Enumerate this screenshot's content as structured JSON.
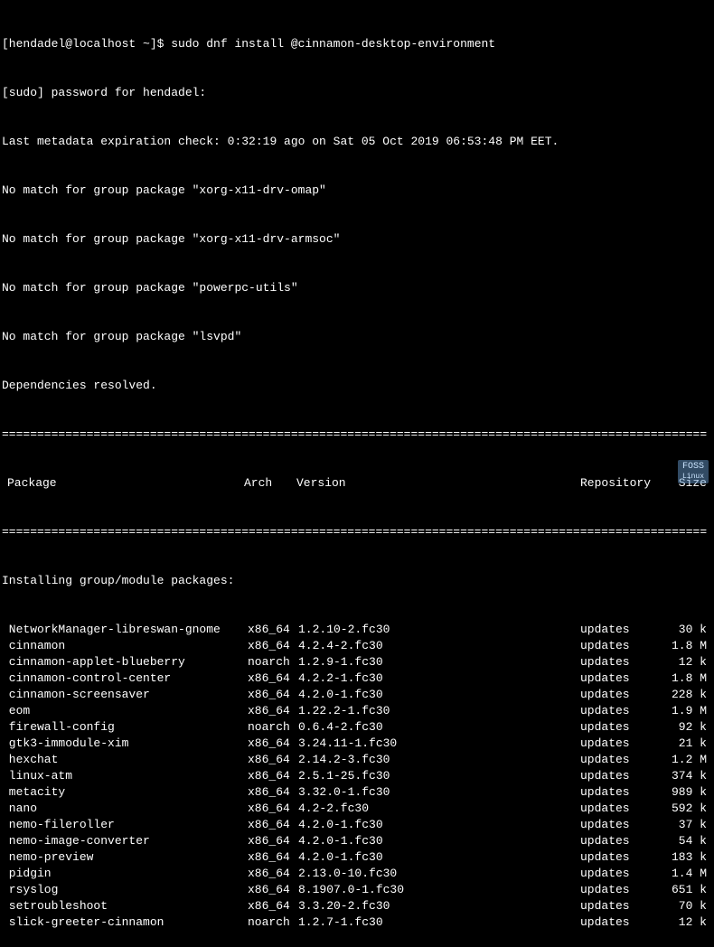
{
  "prompt": {
    "user_host": "[hendadel@localhost ~]$ ",
    "command": "sudo dnf install @cinnamon-desktop-environment",
    "sudo_line": "[sudo] password for hendadel:",
    "metadata_line": "Last metadata expiration check: 0:32:19 ago on Sat 05 Oct 2019 06:53:48 PM EET.",
    "no_match_lines": [
      "No match for group package \"xorg-x11-drv-omap\"",
      "No match for group package \"xorg-x11-drv-armsoc\"",
      "No match for group package \"powerpc-utils\"",
      "No match for group package \"lsvpd\""
    ],
    "deps_resolved": "Dependencies resolved."
  },
  "divider": "====================================================================================================",
  "headers": {
    "package": "Package",
    "arch": "Arch",
    "version": "Version",
    "repository": "Repository",
    "size": "Size"
  },
  "section_title": "Installing group/module packages:",
  "packages": [
    {
      "name": " NetworkManager-libreswan-gnome",
      "arch": "x86_64",
      "version": "1.2.10-2.fc30",
      "repo": "updates",
      "size": "30 k"
    },
    {
      "name": " cinnamon",
      "arch": "x86_64",
      "version": "4.2.4-2.fc30",
      "repo": "updates",
      "size": "1.8 M"
    },
    {
      "name": " cinnamon-applet-blueberry",
      "arch": "noarch",
      "version": "1.2.9-1.fc30",
      "repo": "updates",
      "size": "12 k"
    },
    {
      "name": " cinnamon-control-center",
      "arch": "x86_64",
      "version": "4.2.2-1.fc30",
      "repo": "updates",
      "size": "1.8 M"
    },
    {
      "name": " cinnamon-screensaver",
      "arch": "x86_64",
      "version": "4.2.0-1.fc30",
      "repo": "updates",
      "size": "228 k"
    },
    {
      "name": " eom",
      "arch": "x86_64",
      "version": "1.22.2-1.fc30",
      "repo": "updates",
      "size": "1.9 M"
    },
    {
      "name": " firewall-config",
      "arch": "noarch",
      "version": "0.6.4-2.fc30",
      "repo": "updates",
      "size": "92 k"
    },
    {
      "name": " gtk3-immodule-xim",
      "arch": "x86_64",
      "version": "3.24.11-1.fc30",
      "repo": "updates",
      "size": "21 k"
    },
    {
      "name": " hexchat",
      "arch": "x86_64",
      "version": "2.14.2-3.fc30",
      "repo": "updates",
      "size": "1.2 M"
    },
    {
      "name": " linux-atm",
      "arch": "x86_64",
      "version": "2.5.1-25.fc30",
      "repo": "updates",
      "size": "374 k"
    },
    {
      "name": " metacity",
      "arch": "x86_64",
      "version": "3.32.0-1.fc30",
      "repo": "updates",
      "size": "989 k"
    },
    {
      "name": " nano",
      "arch": "x86_64",
      "version": "4.2-2.fc30",
      "repo": "updates",
      "size": "592 k"
    },
    {
      "name": " nemo-fileroller",
      "arch": "x86_64",
      "version": "4.2.0-1.fc30",
      "repo": "updates",
      "size": "37 k"
    },
    {
      "name": " nemo-image-converter",
      "arch": "x86_64",
      "version": "4.2.0-1.fc30",
      "repo": "updates",
      "size": "54 k"
    },
    {
      "name": " nemo-preview",
      "arch": "x86_64",
      "version": "4.2.0-1.fc30",
      "repo": "updates",
      "size": "183 k"
    },
    {
      "name": " pidgin",
      "arch": "x86_64",
      "version": "2.13.0-10.fc30",
      "repo": "updates",
      "size": "1.4 M"
    },
    {
      "name": " rsyslog",
      "arch": "x86_64",
      "version": "8.1907.0-1.fc30",
      "repo": "updates",
      "size": "651 k"
    },
    {
      "name": " setroubleshoot",
      "arch": "x86_64",
      "version": "3.3.20-2.fc30",
      "repo": "updates",
      "size": "70 k"
    },
    {
      "name": " slick-greeter-cinnamon",
      "arch": "noarch",
      "version": "1.2.7-1.fc30",
      "repo": "updates",
      "size": "12 k"
    }
  ],
  "watermark": {
    "line1": "FOSS",
    "line2": "Linux"
  }
}
